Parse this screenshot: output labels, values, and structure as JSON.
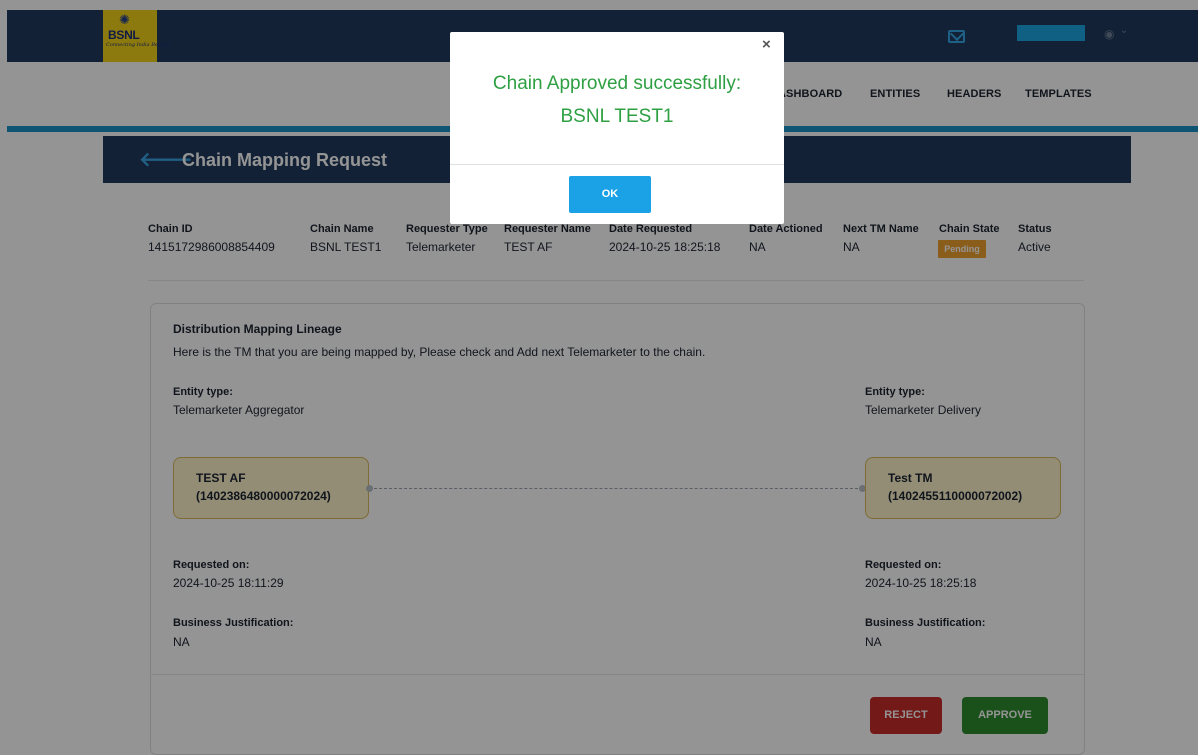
{
  "header": {
    "logo_text": "BSNL",
    "logo_tagline": "Connecting India Beyond"
  },
  "nav": {
    "items": [
      "ASHBOARD",
      "ENTITIES",
      "HEADERS",
      "TEMPLATES"
    ]
  },
  "page": {
    "title": "Chain Mapping Request"
  },
  "chain_info": {
    "columns": [
      {
        "label": "Chain ID",
        "value": "1415172986008854409"
      },
      {
        "label": "Chain Name",
        "value": "BSNL TEST1"
      },
      {
        "label": "Requester Type",
        "value": "Telemarketer"
      },
      {
        "label": "Requester Name",
        "value": "TEST AF"
      },
      {
        "label": "Date Requested",
        "value": "2024-10-25 18:25:18"
      },
      {
        "label": "Date Actioned",
        "value": "NA"
      },
      {
        "label": "Next TM Name",
        "value": "NA"
      },
      {
        "label": "Chain State",
        "value": "Pending"
      },
      {
        "label": "Status",
        "value": "Active"
      }
    ]
  },
  "lineage": {
    "title": "Distribution Mapping Lineage",
    "description": "Here is the TM that you are being mapped by, Please check and Add next Telemarketer to the chain.",
    "left": {
      "entity_type_label": "Entity type:",
      "entity_type": "Telemarketer Aggregator",
      "node_name": "TEST AF",
      "node_id": "(1402386480000072024)",
      "requested_on_label": "Requested on:",
      "requested_on": "2024-10-25 18:11:29",
      "justification_label": "Business Justification:",
      "justification": "NA"
    },
    "right": {
      "entity_type_label": "Entity type:",
      "entity_type": "Telemarketer Delivery",
      "node_name": "Test TM",
      "node_id": "(1402455110000072002)",
      "requested_on_label": "Requested on:",
      "requested_on": "2024-10-25 18:25:18",
      "justification_label": "Business Justification:",
      "justification": "NA"
    }
  },
  "actions": {
    "reject_label": "REJECT",
    "approve_label": "APPROVE"
  },
  "modal": {
    "close_label": "×",
    "message": "Chain Approved successfully: BSNL TEST1",
    "ok_label": "OK"
  },
  "icons": {
    "back": "arrow-left-icon",
    "mail": "mail-icon",
    "account": "account-icon"
  },
  "colors": {
    "header_bg": "#203a5e",
    "accent": "#1993c8",
    "pending_badge": "#f0a130",
    "reject": "#c62b28",
    "approve": "#2e8b2e",
    "success_text": "#2ea043",
    "ok_button": "#1aa1e6"
  }
}
